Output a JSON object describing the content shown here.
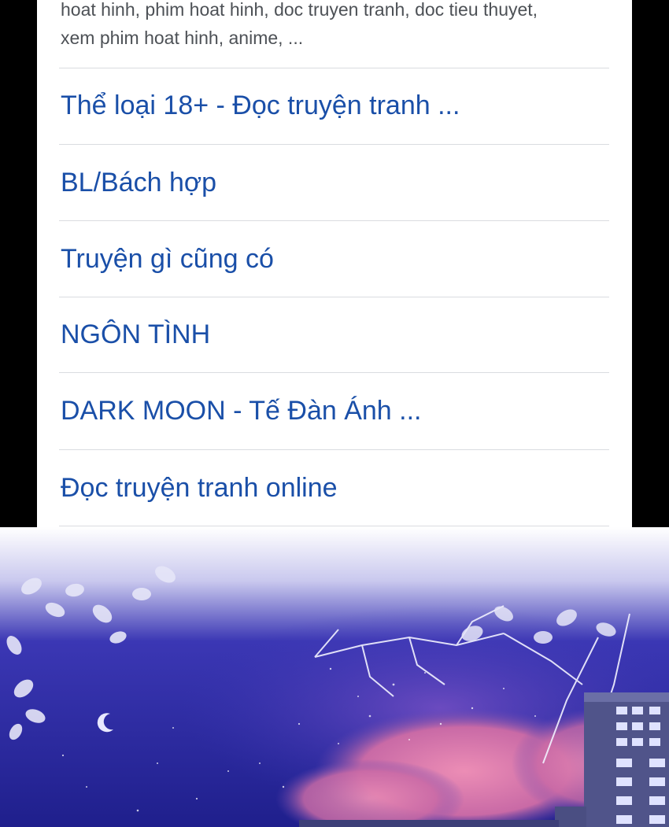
{
  "snippet": {
    "line1": "hoat hinh, phim hoat hinh, doc truyen tranh, doc tieu thuyet,",
    "line2": "xem phim hoat hinh, anime, ..."
  },
  "links": [
    "Thể loại 18+ - Đọc truyện tranh ...",
    "BL/Bách hợp",
    "Truyện gì cũng có",
    "NGÔN TÌNH",
    "DARK MOON - Tế Đàn Ánh ...",
    "Đọc truyện tranh online"
  ],
  "colors": {
    "link": "#1a4fa8",
    "snippet": "#4d5156",
    "divider": "#dadce0",
    "sky_top": "#2a2a9a",
    "cloud_pink": "#e07aa8"
  },
  "icons": [
    "moon-icon",
    "leaf-branch-icon",
    "building-icon"
  ]
}
